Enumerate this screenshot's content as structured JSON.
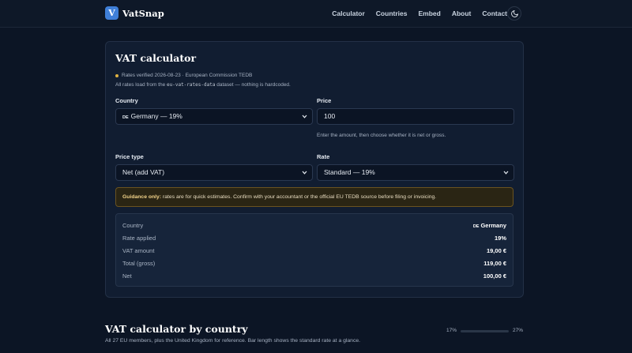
{
  "nav": {
    "logo_letter": "V",
    "brand": "VatSnap",
    "links": [
      "Calculator",
      "Countries",
      "Embed",
      "About",
      "Contact"
    ],
    "theme_icon": "moon-icon"
  },
  "calculator": {
    "title": "VAT calculator",
    "verified_text": "Rates verified 2026-08-23 · European Commission TEDB",
    "source_prefix": "All rates load from the ",
    "source_dataset": "eu-vat-rates-data",
    "source_suffix": " dataset — nothing is hardcoded.",
    "country": {
      "label": "Country",
      "flag": "DE",
      "value": "Germany — 19%"
    },
    "price": {
      "label": "Price",
      "value": "100",
      "hint": "Enter the amount, then choose whether it is net or gross."
    },
    "price_type": {
      "label": "Price type",
      "value": "Net (add VAT)"
    },
    "rate": {
      "label": "Rate",
      "value": "Standard — 19%"
    },
    "guidance": {
      "bold": "Guidance only:",
      "text": " rates are for quick estimates. Confirm with your accountant or the official EU TEDB source before filing or invoicing."
    },
    "results": {
      "country": {
        "label": "Country",
        "flag": "DE",
        "value": "Germany"
      },
      "rate": {
        "label": "Rate applied",
        "value": "19%"
      },
      "vat": {
        "label": "VAT amount",
        "value": "19,00 €"
      },
      "total": {
        "label": "Total (gross)",
        "value": "119,00 €"
      },
      "net": {
        "label": "Net",
        "value": "100,00 €"
      }
    }
  },
  "by_country": {
    "title": "VAT calculator by country",
    "subtitle": "All 27 EU members, plus the United Kingdom for reference. Bar length shows the standard rate at a glance.",
    "scale_min": "17%",
    "scale_max": "27%"
  },
  "colors": {
    "accent": "#3f7fd8",
    "warning_dot": "#e0b341",
    "background": "#0c1525"
  }
}
